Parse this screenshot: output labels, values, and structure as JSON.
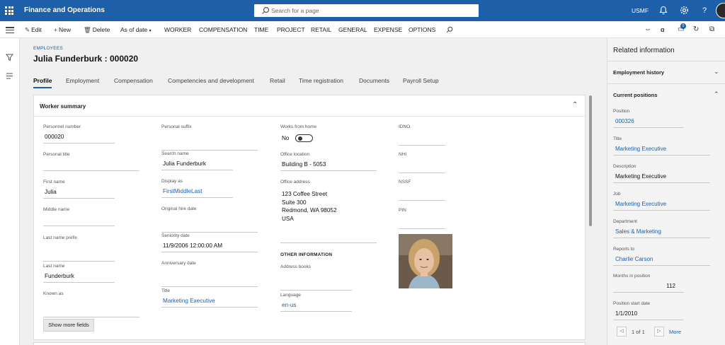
{
  "app": {
    "title": "Finance and Operations",
    "search_placeholder": "Search for a page",
    "company": "USMF",
    "accent_color": "#1d5fa8"
  },
  "icons": {
    "waffle": "waffle-icon",
    "search": "search-icon",
    "bell": "bell-icon",
    "gear": "gear-icon",
    "help": "help-icon",
    "avatar": "user-avatar"
  },
  "actions": {
    "edit": "Edit",
    "new": "New",
    "delete": "Delete",
    "as_of_date": "As of date",
    "worker": "WORKER",
    "compensation": "COMPENSATION",
    "time": "TIME",
    "project": "PROJECT",
    "retail": "RETAIL",
    "general": "GENERAL",
    "expense": "EXPENSE",
    "options": "OPTIONS",
    "notification_count": "0"
  },
  "page": {
    "breadcrumb": "EMPLOYEES",
    "title": "Julia Funderburk : 000020",
    "tabs": [
      "Profile",
      "Employment",
      "Compensation",
      "Competencies and development",
      "Retail",
      "Time registration",
      "Documents",
      "Payroll Setup"
    ],
    "active_tab": "Profile"
  },
  "worker_summary": {
    "title": "Worker summary",
    "col1": [
      {
        "label": "Personnel number",
        "value": "000020"
      },
      {
        "label": "Personal title",
        "value": ""
      },
      {
        "label": "First name",
        "value": "Julia"
      },
      {
        "label": "Middle name",
        "value": ""
      },
      {
        "label": "Last name prefix",
        "value": ""
      },
      {
        "label": "Last name",
        "value": "Funderburk"
      },
      {
        "label": "Known as",
        "value": ""
      }
    ],
    "col2": [
      {
        "label": "Personal suffix",
        "value": ""
      },
      {
        "label": "Search name",
        "value": "Julia Funderburk"
      },
      {
        "label": "Display as",
        "value": "FirstMiddleLast"
      },
      {
        "label": "Original hire date",
        "value": ""
      },
      {
        "label": "Seniority date",
        "value": "11/9/2006 12:00:00 AM"
      },
      {
        "label": "Anniversary date",
        "value": ""
      },
      {
        "label": "Title",
        "value": "Marketing Executive"
      }
    ],
    "col3": {
      "works_from_home_label": "Works from home",
      "works_from_home_value": "No",
      "office_location_label": "Office location",
      "office_location": "Building B - 5053",
      "office_address_label": "Office address",
      "address_lines": [
        "123 Coffee Street",
        "Suite 300",
        "Redmond, WA 98052",
        "USA"
      ],
      "other_info_head": "OTHER INFORMATION",
      "address_books_label": "Address books",
      "address_books": "",
      "language_label": "Language",
      "language": "en-us"
    },
    "col4": [
      {
        "label": "IDNO",
        "value": ""
      },
      {
        "label": "NHI",
        "value": ""
      },
      {
        "label": "NSSF",
        "value": ""
      },
      {
        "label": "PIN",
        "value": ""
      }
    ],
    "show_more": "Show more fields"
  },
  "related": {
    "title": "Related information",
    "employment_history": "Employment history",
    "current_positions": "Current positions",
    "fields": [
      {
        "label": "Position",
        "value": "000326"
      },
      {
        "label": "Title",
        "value": "Marketing Executive"
      },
      {
        "label": "Description",
        "value": "Marketing Executive"
      },
      {
        "label": "Job",
        "value": "Marketing Executive"
      },
      {
        "label": "Department",
        "value": "Sales & Marketing"
      },
      {
        "label": "Reports to",
        "value": "Charlie Carson"
      },
      {
        "label": "Months in position",
        "value": "112"
      },
      {
        "label": "Position start date",
        "value": "1/1/2010"
      }
    ],
    "pager_text": "1 of 1",
    "more": "More"
  }
}
